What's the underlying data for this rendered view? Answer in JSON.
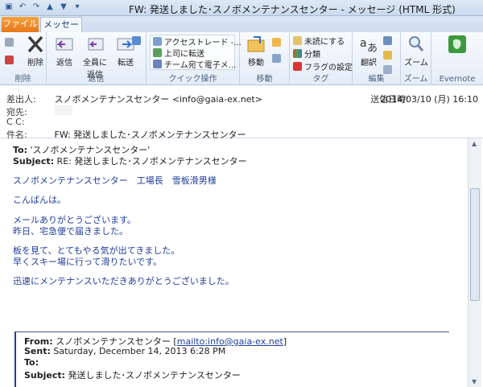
{
  "window": {
    "title": "FW: 発送しました･スノボメンテナンスセンター - メッセージ (HTML 形式)"
  },
  "tabs": {
    "file": "ファイル",
    "message": "メッセージ"
  },
  "ribbon": {
    "groups": {
      "delete": {
        "label": "削除",
        "delete_label": "削除"
      },
      "respond": {
        "label": "返信",
        "reply": "返信",
        "reply_all_1": "全員に",
        "reply_all_2": "返信",
        "forward": "転送"
      },
      "quicksteps": {
        "label": "クイック操作",
        "item1": "アクセストレード -...",
        "item2": "上司に転送",
        "item3": "チーム宛て電子メ..."
      },
      "move": {
        "label": "移動",
        "move": "移動"
      },
      "tags": {
        "label": "タグ",
        "unread": "未読にする",
        "categorize": "分類",
        "followup": "フラグの設定"
      },
      "editing": {
        "label": "編集",
        "translate": "翻訳"
      },
      "zoom": {
        "label": "ズーム",
        "zoom": "ズーム"
      },
      "evernote": {
        "label": "Evernote"
      }
    }
  },
  "header": {
    "from_label": "差出人:",
    "from_value": "スノボメンテナンスセンター <info@gaia-ex.net>",
    "to_label": "宛先:",
    "cc_label": "C C:",
    "subject_label": "件名:",
    "subject_value": "FW: 発送しました･スノボメンテナンスセンター",
    "sent_label": "送信日時:",
    "sent_value": "2014/03/10 (月) 16:10"
  },
  "body": {
    "to_line_label": "To:",
    "to_line_value": "'スノボメンテナンスセンター'",
    "subject_line_label": "Subject:",
    "subject_line_value": "RE: 発送しました･スノボメンテナンスセンター",
    "greeting_to": "スノボメンテナンスセンター　工場長　雪板滑男様",
    "hello": "こんばんは。",
    "thanks1": "メールありがとうございます。",
    "thanks2": "昨日、宅急便で届きました。",
    "board1": "板を見て、とてもやる気が出てきました。",
    "board2": "早くスキー場に行って滑りたいです。",
    "quick": "迅速にメンテナンスいただきありがとうございました。",
    "fwd_from_label": "From:",
    "fwd_from_name": "スノボメンテナンスセンター",
    "fwd_from_link": "mailto:info@gaia-ex.net",
    "fwd_sent_label": "Sent:",
    "fwd_sent_value": "Saturday, December 14, 2013 6:28 PM",
    "fwd_to_label": "To:",
    "fwd_subject_label": "Subject:",
    "fwd_subject_value": "発送しました･スノボメンテナンスセンター"
  }
}
